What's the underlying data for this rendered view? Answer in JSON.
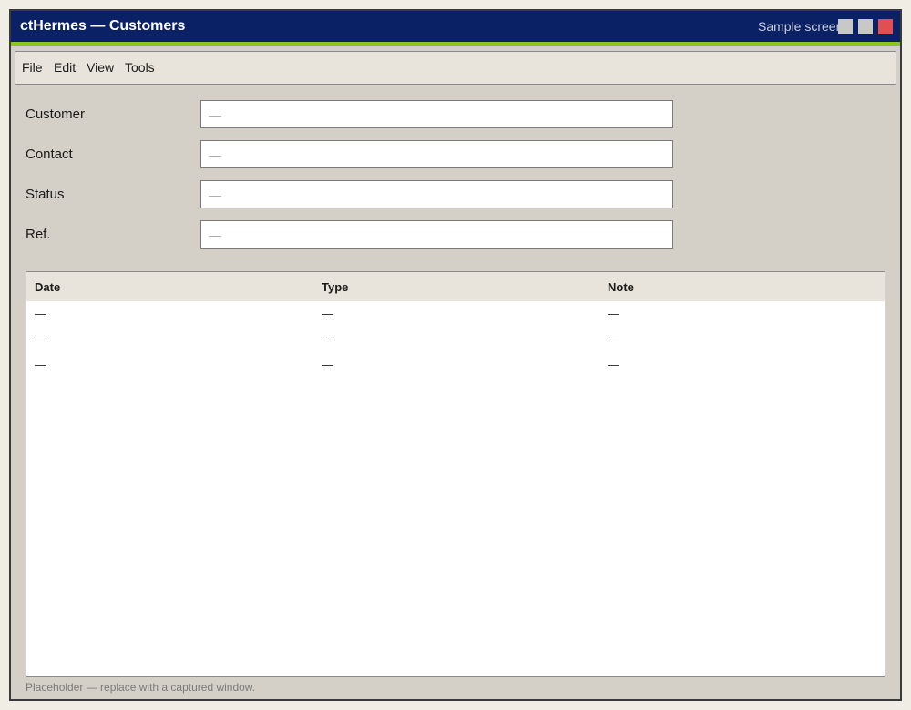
{
  "window": {
    "title": "ctHermes — Customers",
    "note": "Sample screen"
  },
  "menu": {
    "items": [
      "File",
      "Edit",
      "View",
      "Tools"
    ]
  },
  "form": {
    "fields": [
      {
        "label": "Customer",
        "placeholder": "—"
      },
      {
        "label": "Contact",
        "placeholder": "—"
      },
      {
        "label": "Status",
        "placeholder": "—"
      },
      {
        "label": "Ref.",
        "placeholder": "—"
      }
    ]
  },
  "table": {
    "columns": [
      "Date",
      "Type",
      "Note"
    ],
    "rows": [
      [
        "—",
        "—",
        "—"
      ],
      [
        "—",
        "—",
        "—"
      ],
      [
        "—",
        "—",
        "—"
      ]
    ]
  },
  "footer": {
    "note": "Placeholder — replace with a captured window."
  },
  "colors": {
    "titlebar": "#0a2265",
    "accent_stripe": "#8fc31f",
    "close_button": "#e05050",
    "window_bg": "#d4d0c8"
  }
}
